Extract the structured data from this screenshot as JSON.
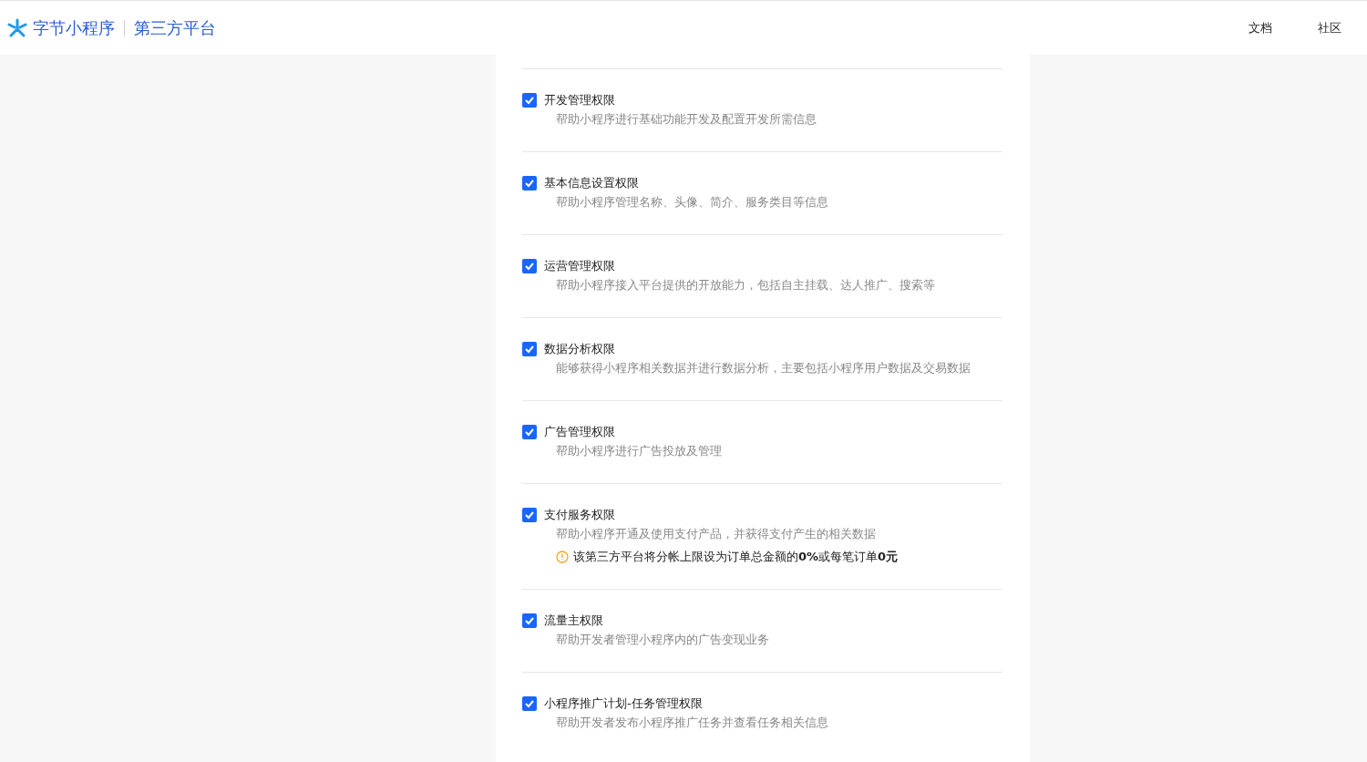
{
  "header": {
    "brand": "字节小程序",
    "platform": "第三方平台",
    "links": [
      "文档",
      "社区"
    ]
  },
  "permissions": [
    {
      "title": "开发管理权限",
      "description": "帮助小程序进行基础功能开发及配置开发所需信息",
      "checked": true
    },
    {
      "title": "基本信息设置权限",
      "description": "帮助小程序管理名称、头像、简介、服务类目等信息",
      "checked": true
    },
    {
      "title": "运营管理权限",
      "description": "帮助小程序接入平台提供的开放能力，包括自主挂载、达人推广、搜索等",
      "checked": true
    },
    {
      "title": "数据分析权限",
      "description": "能够获得小程序相关数据并进行数据分析，主要包括小程序用户数据及交易数据",
      "checked": true
    },
    {
      "title": "广告管理权限",
      "description": "帮助小程序进行广告投放及管理",
      "checked": true
    },
    {
      "title": "支付服务权限",
      "description": "帮助小程序开通及使用支付产品，并获得支付产生的相关数据",
      "checked": true,
      "notice": "该第三方平台将分帐上限设为订单总金额的**0%**或每笔订单**0元**"
    },
    {
      "title": "流量主权限",
      "description": "帮助开发者管理小程序内的广告变现业务",
      "checked": true
    },
    {
      "title": "小程序推广计划-任务管理权限",
      "description": "帮助开发者发布小程序推广任务并查看任务相关信息",
      "checked": true
    }
  ]
}
